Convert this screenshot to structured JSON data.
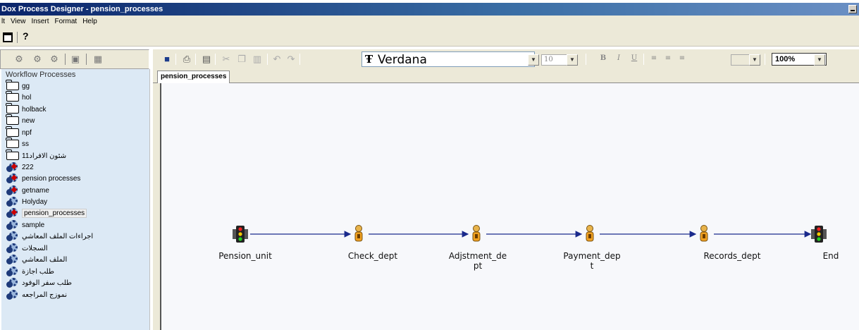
{
  "window": {
    "title": "Dox Process Designer - pension_processes"
  },
  "menu": [
    "lt",
    "View",
    "Insert",
    "Format",
    "Help"
  ],
  "font_toolbar": {
    "font_name": "Verdana",
    "font_size": "10",
    "zoom": "100%"
  },
  "left_panel": {
    "title": "Workflow Processes",
    "folders": [
      "gg",
      "hol",
      "holback",
      "new",
      "npf",
      "ss",
      "شئون الافراد11"
    ],
    "processes": [
      "222",
      "pension processes",
      "getname",
      "Holyday",
      "pension_processes",
      "sample",
      "اجراءات الملف المعاشي",
      "السجلات",
      "الملف المعاشي",
      "طلب اجازة",
      "طلب سفر الوفود",
      "نموزج المراجعه"
    ],
    "selected": "pension_processes"
  },
  "tab": {
    "label": "pension_processes"
  },
  "workflow": {
    "nodes": [
      {
        "label": "Pension_unit",
        "type": "traffic-light"
      },
      {
        "label": "Check_dept",
        "type": "activity"
      },
      {
        "label": "Adjstment_de\npt",
        "type": "activity"
      },
      {
        "label": "Payment_dep\nt",
        "type": "activity"
      },
      {
        "label": "Records_dept",
        "type": "activity"
      },
      {
        "label": "End",
        "type": "traffic-light"
      }
    ]
  }
}
